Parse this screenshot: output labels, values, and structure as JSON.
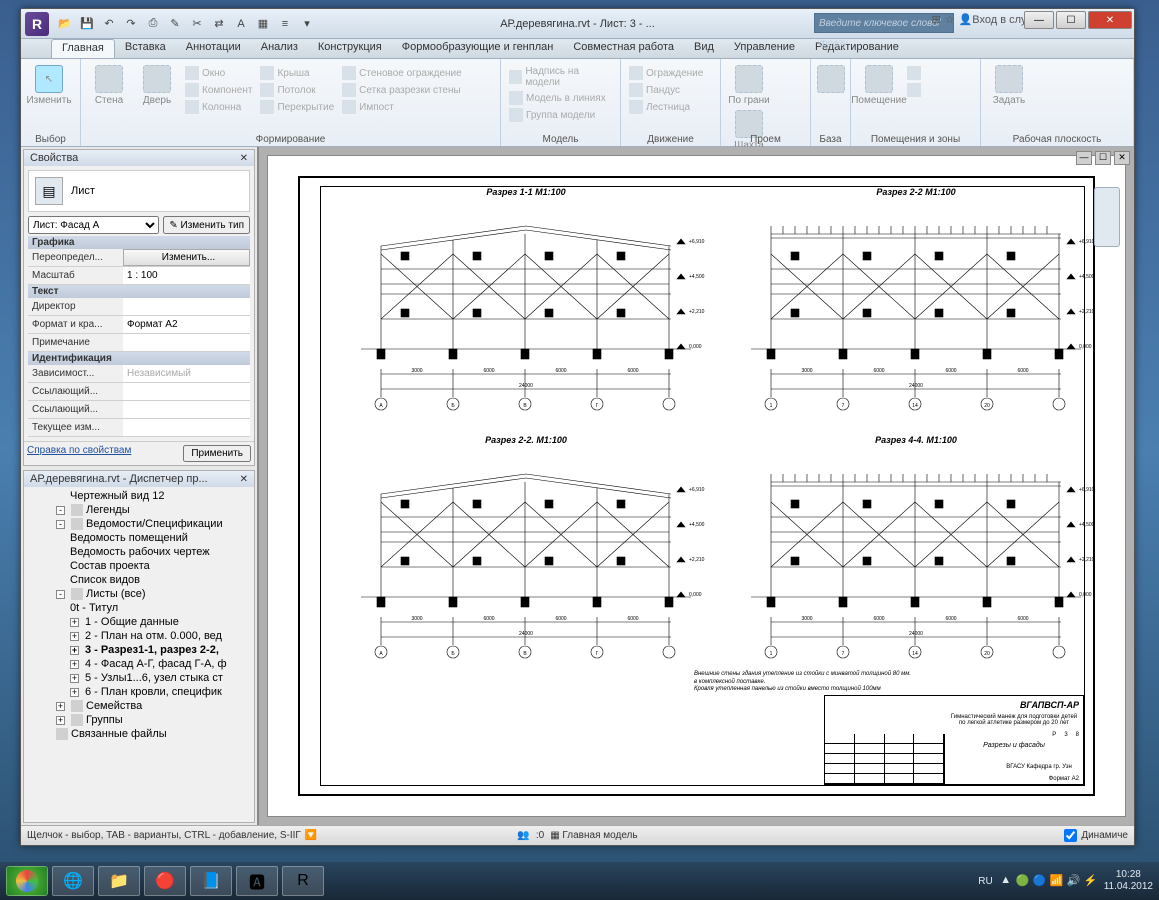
{
  "window": {
    "title": "АР.деревягина.rvt - Лист: 3 - ...",
    "search_placeholder": "Введите ключевое слово/фразу",
    "signin": "Вход в службы"
  },
  "qat": [
    "open",
    "save",
    "undo",
    "redo",
    "print",
    "measure",
    "select",
    "text",
    "dim",
    "properties",
    "3d"
  ],
  "ribbon_tabs": [
    "Главная",
    "Вставка",
    "Аннотации",
    "Анализ",
    "Конструкция",
    "Формообразующие и генплан",
    "Совместная работа",
    "Вид",
    "Управление",
    "Редактирование"
  ],
  "ribbon_active": 0,
  "ribbon_panels": {
    "select": {
      "label": "Выбор",
      "main": "Изменить"
    },
    "forming": {
      "label": "Формирование",
      "items_col1": [
        "Стена",
        "Дверь"
      ],
      "items_col2": [
        "Окно",
        "Компонент",
        "Колонна"
      ],
      "items_col3": [
        "Крыша",
        "Потолок",
        "Перекрытие"
      ],
      "items_col4": [
        "Стеновое ограждение",
        "Сетка разрезки стены",
        "Импост"
      ]
    },
    "model": {
      "label": "Модель",
      "items": [
        "Надпись на модели",
        "Модель в линиях",
        "Группа модели"
      ]
    },
    "movement": {
      "label": "Движение",
      "items": [
        "Ограждение",
        "Пандус",
        "Лестница"
      ]
    },
    "opening": {
      "label": "Проем",
      "main1": "По грани",
      "main2": "Шахта"
    },
    "base": {
      "label": "База"
    },
    "rooms": {
      "label": "Помещения и зоны",
      "main": "Помещение"
    },
    "workplane": {
      "label": "Рабочая плоскость",
      "main": "Задать"
    }
  },
  "properties": {
    "panel_title": "Свойства",
    "type_name": "Лист",
    "type_selector": "Лист: Фасад А",
    "edit_type_btn": "Изменить тип",
    "groups": {
      "graphics": "Графика",
      "text": "Текст",
      "ident": "Идентификация"
    },
    "rows": [
      {
        "k": "Переопредел...",
        "v": "Изменить...",
        "btn": true
      },
      {
        "k": "Масштаб",
        "v": "1 : 100"
      },
      {
        "k": "Директор",
        "v": ""
      },
      {
        "k": "Формат и кра...",
        "v": "Формат А2"
      },
      {
        "k": "Примечание",
        "v": ""
      },
      {
        "k": "Зависимост...",
        "v": "Независимый"
      },
      {
        "k": "Ссылающий...",
        "v": ""
      },
      {
        "k": "Ссылающий...",
        "v": ""
      },
      {
        "k": "Текущее изм...",
        "v": ""
      }
    ],
    "help_link": "Справка по свойствам",
    "apply": "Применить"
  },
  "browser": {
    "title": "АР.деревягина.rvt - Диспетчер пр...",
    "items": [
      {
        "lvl": 2,
        "label": "Чертежный вид 12"
      },
      {
        "lvl": 1,
        "exp": "-",
        "ico": "legend",
        "label": "Легенды"
      },
      {
        "lvl": 1,
        "exp": "-",
        "ico": "sched",
        "label": "Ведомости/Спецификации"
      },
      {
        "lvl": 2,
        "label": "Ведомость помещений"
      },
      {
        "lvl": 2,
        "label": "Ведомость рабочих чертеж"
      },
      {
        "lvl": 2,
        "label": "Состав проекта"
      },
      {
        "lvl": 2,
        "label": "Список видов"
      },
      {
        "lvl": 1,
        "exp": "-",
        "ico": "sheet",
        "label": "Листы (все)"
      },
      {
        "lvl": 2,
        "label": "0t - Титул"
      },
      {
        "lvl": 2,
        "exp": "+",
        "label": "1 - Общие данные"
      },
      {
        "lvl": 2,
        "exp": "+",
        "label": "2 - План на отм. 0.000, вед"
      },
      {
        "lvl": 2,
        "exp": "+",
        "label": "3 - Разрез1-1, разрез 2-2,",
        "sel": true
      },
      {
        "lvl": 2,
        "exp": "+",
        "label": "4 - Фасад А-Г, фасад Г-А, ф"
      },
      {
        "lvl": 2,
        "exp": "+",
        "label": "5 - Узлы1...6, узел стыка ст"
      },
      {
        "lvl": 2,
        "exp": "+",
        "label": "6 - План кровли, специфик"
      },
      {
        "lvl": 1,
        "exp": "+",
        "ico": "fam",
        "label": "Семейства"
      },
      {
        "lvl": 1,
        "exp": "+",
        "ico": "grp",
        "label": "Группы"
      },
      {
        "lvl": 1,
        "ico": "link",
        "label": "Связанные файлы"
      }
    ]
  },
  "drawings": {
    "sec1": "Разрез 1-1 М1:100",
    "sec2": "Разрез 2-2 М1:100",
    "sec3": "Разрез 2-2. М1:100",
    "sec4": "Разрез 4-4. М1:100",
    "axes": [
      "А",
      "Б",
      "В",
      "Г"
    ],
    "axes_num": [
      "1",
      "7",
      "14",
      "20"
    ],
    "elev": [
      "0,000",
      "+2,210",
      "+4,500",
      "+6,910"
    ],
    "dims": [
      "3000",
      "6000",
      "6000",
      "6000",
      "3000"
    ],
    "span_dim": "24000"
  },
  "titleblock": {
    "project": "ВГАПВСП-АР",
    "desc": "Гимнастический манеж для подготовки детей по легкой атлетике размером до 20 лет",
    "sheet_name": "Разрезы и фасады",
    "org": "ВГАСУ Кафедра гр. Узн",
    "format": "Формат А2",
    "stage": "Р",
    "sheet": "3",
    "sheets": "8"
  },
  "notes": {
    "l1": "Внешние стены здания утепление из стойки с минватой толщиной 80 мм.",
    "l2": "в комплексной поставке.",
    "l3": "Кровля утепленная панелью из стойки вместо толщиной 100мм"
  },
  "statusbar": {
    "hint": "Щелчок - выбор, TAB - варианты, CTRL - добавление, S-IIГ",
    "zoom": ":0",
    "model": "Главная модель",
    "dyn": "Динамиче"
  },
  "taskbar": {
    "lang": "RU",
    "time": "10:28",
    "date": "11.04.2012"
  }
}
